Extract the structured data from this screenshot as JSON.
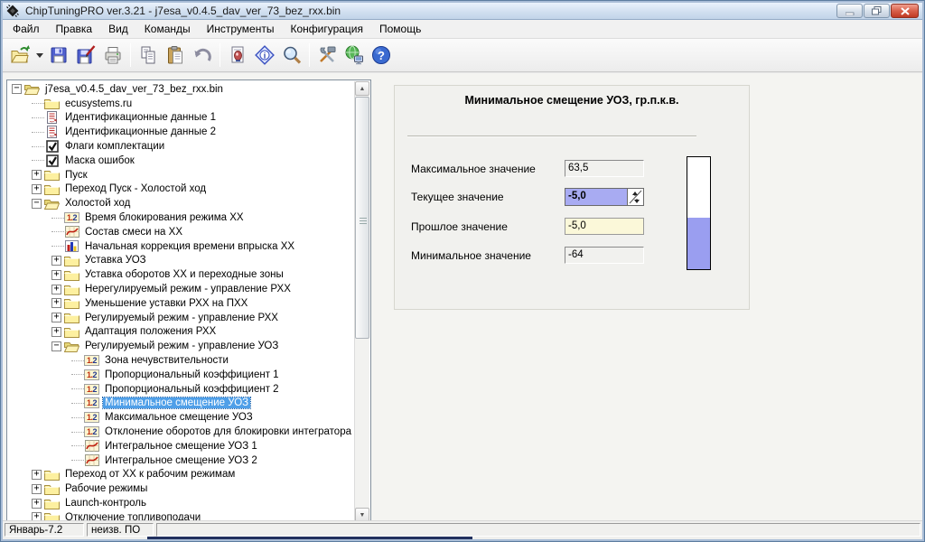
{
  "window": {
    "title": "ChipTuningPRO ver.3.21 - j7esa_v0.4.5_dav_ver_73_bez_rxx.bin",
    "controls": [
      "minimize",
      "restore",
      "close"
    ]
  },
  "menu": {
    "items": [
      "Файл",
      "Правка",
      "Вид",
      "Команды",
      "Инструменты",
      "Конфигурация",
      "Помощь"
    ]
  },
  "toolbar": {
    "groups": [
      [
        {
          "name": "open-file-button",
          "icon": "open-folder-icon"
        },
        {
          "name": "open-dropdown-button",
          "icon": "chevron-down-icon"
        },
        {
          "name": "save-button",
          "icon": "save-icon"
        },
        {
          "name": "save-as-button",
          "icon": "save-as-icon"
        },
        {
          "name": "print-button",
          "icon": "print-icon"
        }
      ],
      [
        {
          "name": "copy-button",
          "icon": "copy-icon"
        },
        {
          "name": "paste-button",
          "icon": "paste-icon"
        },
        {
          "name": "undo-button",
          "icon": "undo-icon"
        }
      ],
      [
        {
          "name": "report-button",
          "icon": "report-icon"
        },
        {
          "name": "info-button",
          "icon": "info-icon"
        },
        {
          "name": "search-button",
          "icon": "search-icon"
        }
      ],
      [
        {
          "name": "tools-button",
          "icon": "tools-icon"
        },
        {
          "name": "network-button",
          "icon": "network-icon"
        },
        {
          "name": "help-button",
          "icon": "help-icon"
        }
      ]
    ]
  },
  "icons": {
    "num_label_1": "1.",
    "num_label_2": "2"
  },
  "tree": {
    "items": [
      {
        "label": "j7esa_v0.4.5_dav_ver_73_bez_rxx.bin",
        "icon": "folder-open",
        "level": 0,
        "expander": "minus",
        "selected": false
      },
      {
        "label": "ecusystems.ru",
        "icon": "folder",
        "level": 1,
        "expander": "none",
        "selected": false
      },
      {
        "label": "Идентификационные данные 1",
        "icon": "doc",
        "level": 1,
        "expander": "none",
        "selected": false
      },
      {
        "label": "Идентификационные данные 2",
        "icon": "doc",
        "level": 1,
        "expander": "none",
        "selected": false
      },
      {
        "label": "Флаги комплектации",
        "icon": "check",
        "level": 1,
        "expander": "none",
        "selected": false
      },
      {
        "label": "Маска ошибок",
        "icon": "check",
        "level": 1,
        "expander": "none",
        "selected": false
      },
      {
        "label": "Пуск",
        "icon": "folder",
        "level": 1,
        "expander": "plus",
        "selected": false
      },
      {
        "label": "Переход Пуск - Холостой ход",
        "icon": "folder",
        "level": 1,
        "expander": "plus",
        "selected": false
      },
      {
        "label": "Холостой ход",
        "icon": "folder-open",
        "level": 1,
        "expander": "minus",
        "selected": false
      },
      {
        "label": "Время блокирования режима ХХ",
        "icon": "num",
        "level": 2,
        "expander": "none",
        "selected": false
      },
      {
        "label": "Состав смеси на ХХ",
        "icon": "curve",
        "level": 2,
        "expander": "none",
        "selected": false
      },
      {
        "label": "Начальная коррекция времени впрыска ХХ",
        "icon": "bars",
        "level": 2,
        "expander": "none",
        "selected": false
      },
      {
        "label": "Уставка УОЗ",
        "icon": "folder",
        "level": 2,
        "expander": "plus",
        "selected": false
      },
      {
        "label": "Уставка оборотов ХХ и переходные зоны",
        "icon": "folder",
        "level": 2,
        "expander": "plus",
        "selected": false
      },
      {
        "label": "Нерегулируемый режим - управление РХХ",
        "icon": "folder",
        "level": 2,
        "expander": "plus",
        "selected": false
      },
      {
        "label": "Уменьшение уставки РХХ на ПХХ",
        "icon": "folder",
        "level": 2,
        "expander": "plus",
        "selected": false
      },
      {
        "label": "Регулируемый режим - управление РХХ",
        "icon": "folder",
        "level": 2,
        "expander": "plus",
        "selected": false
      },
      {
        "label": "Адаптация положения  РХХ",
        "icon": "folder",
        "level": 2,
        "expander": "plus",
        "selected": false
      },
      {
        "label": "Регулируемый режим - управление УОЗ",
        "icon": "folder-open",
        "level": 2,
        "expander": "minus",
        "selected": false
      },
      {
        "label": "Зона нечувствительности",
        "icon": "num",
        "level": 3,
        "expander": "none",
        "selected": false
      },
      {
        "label": "Пропорциональный коэффициент 1",
        "icon": "num",
        "level": 3,
        "expander": "none",
        "selected": false
      },
      {
        "label": "Пропорциональный коэффициент 2",
        "icon": "num",
        "level": 3,
        "expander": "none",
        "selected": false
      },
      {
        "label": "Минимальное смещение УОЗ",
        "icon": "num",
        "level": 3,
        "expander": "none",
        "selected": true
      },
      {
        "label": "Максимальное смещение УОЗ",
        "icon": "num",
        "level": 3,
        "expander": "none",
        "selected": false
      },
      {
        "label": "Отклонение оборотов для блокировки интегратора",
        "icon": "num",
        "level": 3,
        "expander": "none",
        "selected": false
      },
      {
        "label": "Интегральное смещение УОЗ 1",
        "icon": "curve",
        "level": 3,
        "expander": "none",
        "selected": false
      },
      {
        "label": "Интегральное смещение УОЗ 2",
        "icon": "curve",
        "level": 3,
        "expander": "none",
        "selected": false
      },
      {
        "label": "Переход от ХХ к рабочим режимам",
        "icon": "folder",
        "level": 1,
        "expander": "plus",
        "selected": false
      },
      {
        "label": "Рабочие режимы",
        "icon": "folder",
        "level": 1,
        "expander": "plus",
        "selected": false
      },
      {
        "label": "Launch-контроль",
        "icon": "folder",
        "level": 1,
        "expander": "plus",
        "selected": false
      },
      {
        "label": "Отключение топливоподачи",
        "icon": "folder",
        "level": 1,
        "expander": "plus",
        "selected": false
      }
    ]
  },
  "panel": {
    "title": "Минимальное смещение УОЗ, гр.п.к.в.",
    "fields": [
      {
        "label": "Максимальное значение",
        "value": "63,5",
        "type": "readonly"
      },
      {
        "label": "Текущее значение",
        "value": "-5,0",
        "type": "spinner"
      },
      {
        "label": "Прошлое значение",
        "value": "-5,0",
        "type": "past"
      },
      {
        "label": "Минимальное значение",
        "value": "-64",
        "type": "readonly"
      }
    ],
    "gauge": {
      "min": -64,
      "max": 63.5,
      "value": -5
    }
  },
  "statusbar": {
    "panels": [
      "Январь-7.2",
      "неизв. ПО",
      ""
    ]
  },
  "colors": {
    "selection": "#4f9fe8",
    "spinner_bg": "#a8abf2",
    "past_bg": "#fbf8d9",
    "gauge_fill": "#9a9ef0",
    "close_button": "#c03a24"
  }
}
